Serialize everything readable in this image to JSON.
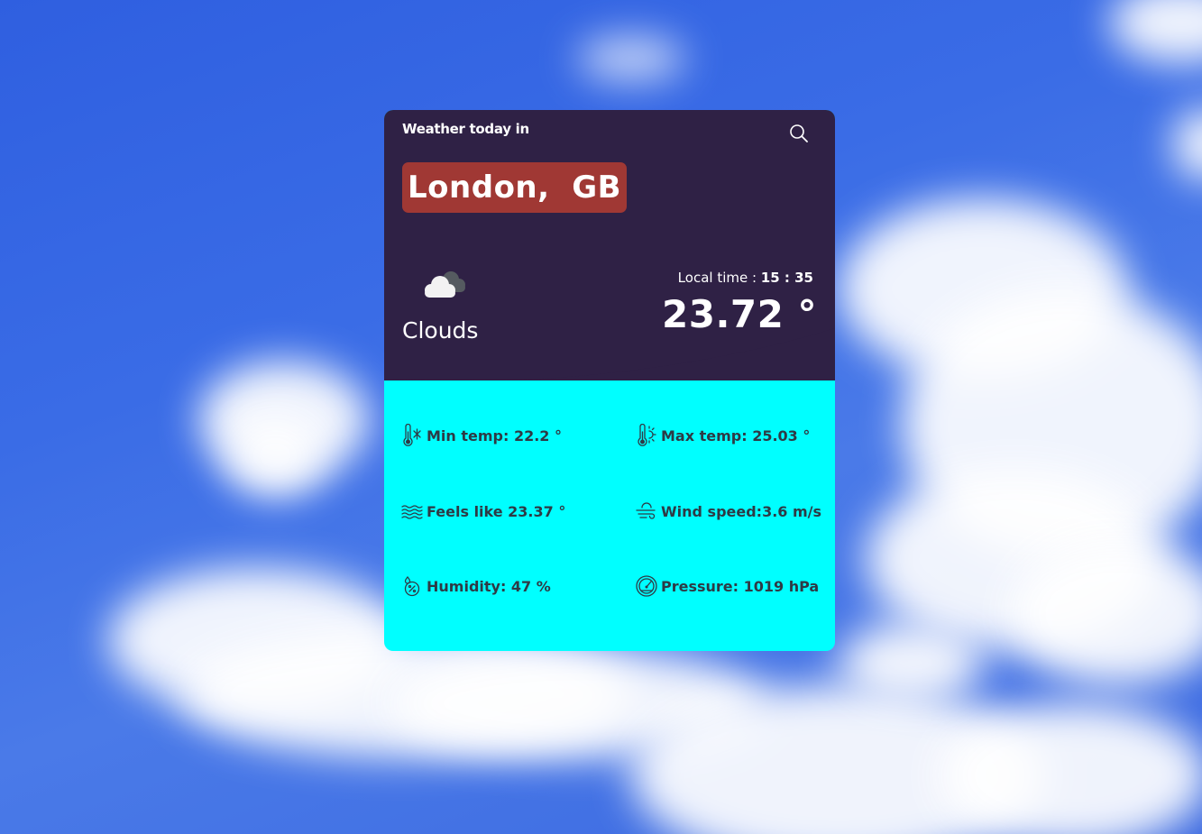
{
  "header": {
    "title": "Weather today in",
    "city": "London,  GB"
  },
  "current": {
    "condition": "Clouds",
    "condition_icon": "clouds-icon",
    "local_time_label": "Local time : ",
    "local_time_value": "15 : 35",
    "temperature": "23.72 °"
  },
  "stats": {
    "min_temp": "Min temp: 22.2 °",
    "max_temp": "Max temp: 25.03 °",
    "feels_like": "Feels like 23.37 °",
    "wind_speed": "Wind speed:3.6 m/s",
    "humidity": "Humidity: 47 %",
    "pressure": "Pressure: 1019 hPa"
  },
  "colors": {
    "card_top": "#2f2145",
    "card_bottom": "#00ffff",
    "city_badge": "#a03834",
    "stat_text": "#2e3a45"
  }
}
